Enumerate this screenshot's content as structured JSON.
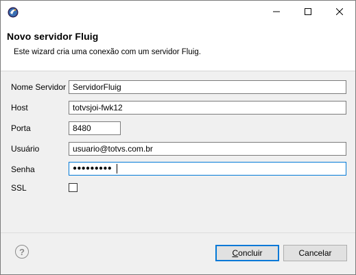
{
  "window": {
    "title": "",
    "icon": "eclipse-icon",
    "controls": {
      "minimize": "minimize-icon",
      "maximize": "maximize-icon",
      "close": "close-icon"
    }
  },
  "header": {
    "title": "Novo servidor Fluig",
    "description": "Este wizard cria uma conexão com um servidor Fluig."
  },
  "form": {
    "server_name": {
      "label": "Nome Servidor",
      "value": "ServidorFluig"
    },
    "host": {
      "label": "Host",
      "value": "totvsjoi-fwk12"
    },
    "port": {
      "label": "Porta",
      "value": "8480"
    },
    "user": {
      "label": "Usuário",
      "value": "usuario@totvs.com.br"
    },
    "password": {
      "label": "Senha",
      "masked": "●●●●●●●●●"
    },
    "ssl": {
      "label": "SSL",
      "checked": false
    }
  },
  "footer": {
    "help_icon": "help-icon",
    "finish_mnemonic": "C",
    "finish_rest": "oncluir",
    "cancel_label": "Cancelar"
  },
  "colors": {
    "accent": "#0078d7",
    "panel": "#f0f0f0"
  }
}
